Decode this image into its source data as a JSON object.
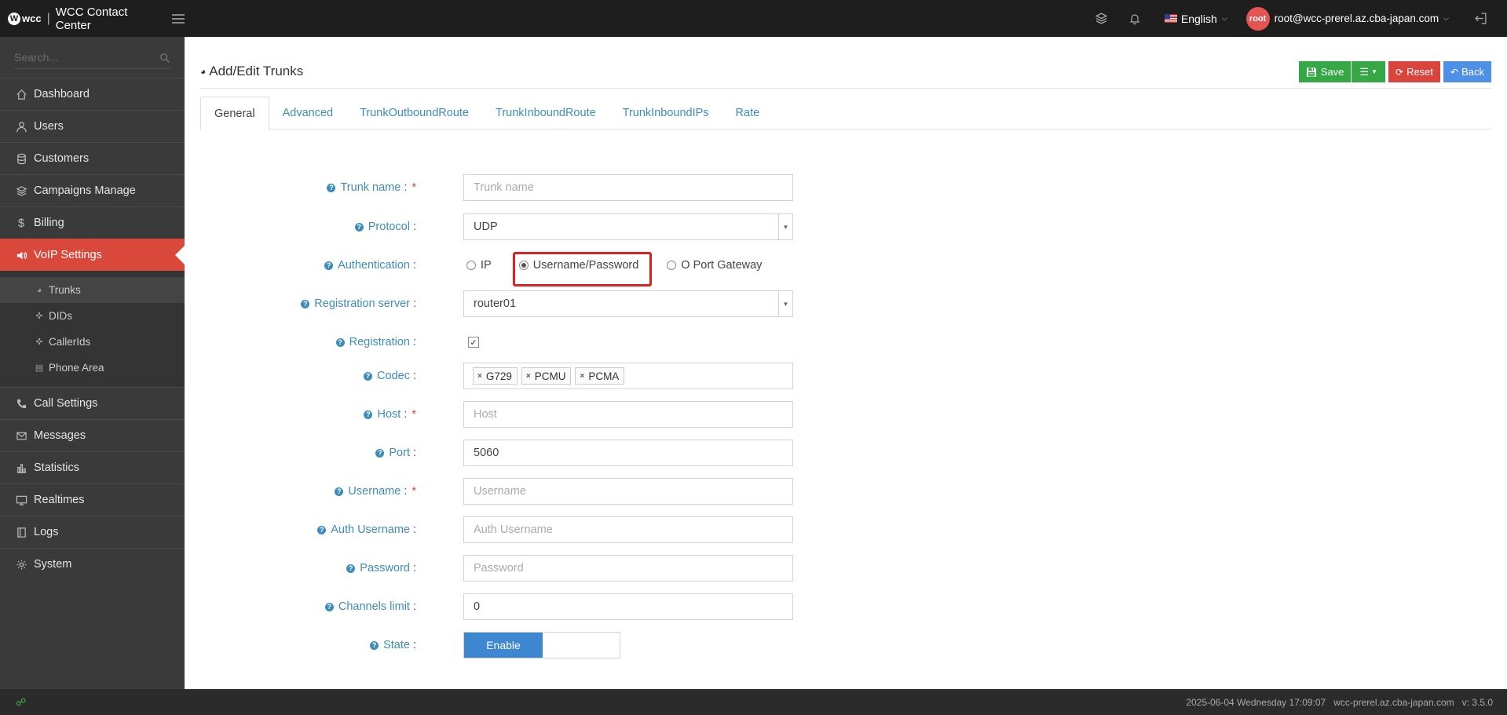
{
  "app": {
    "logo_text": "wcc",
    "title": "WCC Contact Center"
  },
  "topbar": {
    "language": "English",
    "avatar_text": "root",
    "user_email": "root@wcc-prerel.az.cba-japan.com"
  },
  "sidebar": {
    "search_placeholder": "Search...",
    "items": [
      {
        "label": "Dashboard",
        "icon": "home-icon"
      },
      {
        "label": "Users",
        "icon": "user-icon"
      },
      {
        "label": "Customers",
        "icon": "database-icon"
      },
      {
        "label": "Campaigns Manage",
        "icon": "layers-icon"
      },
      {
        "label": "Billing",
        "icon": "dollar-icon"
      },
      {
        "label": "VoIP Settings",
        "icon": "speaker-icon"
      },
      {
        "label": "Call Settings",
        "icon": "phone-icon"
      },
      {
        "label": "Messages",
        "icon": "envelope-icon"
      },
      {
        "label": "Statistics",
        "icon": "bar-chart-icon"
      },
      {
        "label": "Realtimes",
        "icon": "monitor-icon"
      },
      {
        "label": "Logs",
        "icon": "book-icon"
      },
      {
        "label": "System",
        "icon": "gear-icon"
      }
    ],
    "active_item": "VoIP Settings",
    "submenu": [
      {
        "label": "Trunks",
        "icon": "dashboard-icon"
      },
      {
        "label": "DIDs",
        "icon": "crosshair-icon"
      },
      {
        "label": "CallerIds",
        "icon": "crosshair-icon"
      },
      {
        "label": "Phone Area",
        "icon": "book-icon"
      }
    ],
    "active_subitem": "Trunks"
  },
  "page": {
    "title": "Add/Edit Trunks",
    "buttons": {
      "save": "Save",
      "reset": "Reset",
      "back": "Back"
    },
    "tabs": [
      "General",
      "Advanced",
      "TrunkOutboundRoute",
      "TrunkInboundRoute",
      "TrunkInboundIPs",
      "Rate"
    ],
    "active_tab": "General"
  },
  "form": {
    "trunk_name": {
      "label": "Trunk name",
      "placeholder": "Trunk name",
      "value": ""
    },
    "protocol": {
      "label": "Protocol",
      "value": "UDP"
    },
    "authentication": {
      "label": "Authentication",
      "options": [
        "IP",
        "Username/Password",
        "O Port Gateway"
      ],
      "selected": "Username/Password"
    },
    "registration_server": {
      "label": "Registration server",
      "value": "router01"
    },
    "registration": {
      "label": "Registration",
      "checked": true
    },
    "codec": {
      "label": "Codec",
      "values": [
        "G729",
        "PCMU",
        "PCMA"
      ]
    },
    "host": {
      "label": "Host",
      "placeholder": "Host",
      "value": ""
    },
    "port": {
      "label": "Port",
      "value": "5060"
    },
    "username": {
      "label": "Username",
      "placeholder": "Username",
      "value": ""
    },
    "auth_username": {
      "label": "Auth Username",
      "placeholder": "Auth Username",
      "value": ""
    },
    "password": {
      "label": "Password",
      "placeholder": "Password",
      "value": ""
    },
    "channels_limit": {
      "label": "Channels limit",
      "value": "0"
    },
    "state": {
      "label": "State",
      "value": "Enable"
    }
  },
  "footer": {
    "datetime": "2025-06-04 Wednesday 17:09:07",
    "host": "wcc-prerel.az.cba-japan.com",
    "version": "v: 3.5.0"
  },
  "colors": {
    "active_nav": "#d9483b",
    "link": "#3c8dbc",
    "save": "#35a744",
    "reset": "#d9443c",
    "back": "#4d90e6",
    "toggle_on": "#3c87d0",
    "highlight": "#e02020"
  }
}
